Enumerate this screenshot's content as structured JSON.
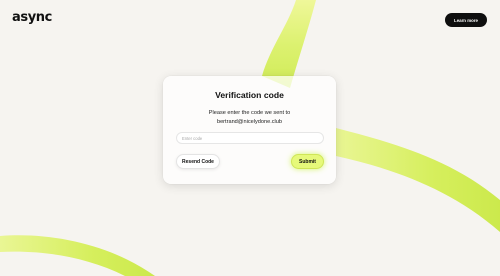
{
  "brand": {
    "logo_text": "async"
  },
  "header": {
    "learn_more_label": "Learn more"
  },
  "verification": {
    "title": "Verification code",
    "description_line1": "Please enter the code we sent to",
    "description_line2": "bertrand@nicelydone.club",
    "code_input": {
      "value": "",
      "placeholder": "Enter code"
    },
    "resend_label": "Resend Code",
    "submit_label": "Submit"
  },
  "colors": {
    "background": "#f6f4f0",
    "accent_lime": "#e6f97a",
    "primary_dark": "#0e0e0e",
    "card_bg": "#ffffff"
  }
}
